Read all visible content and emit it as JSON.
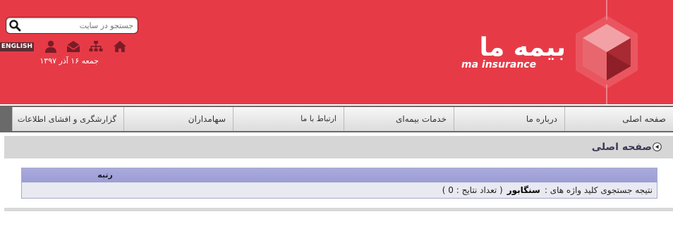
{
  "header": {
    "search": {
      "placeholder": "جستجو در سایت",
      "value": ""
    },
    "english_label": "ENGLISH",
    "date": "جمعه ۱۶ آذر ۱۳۹۷",
    "logo_fa": "بیمه ما",
    "logo_en": "ma insurance",
    "icons": [
      "home-icon",
      "sitemap-icon",
      "mail-icon",
      "user-icon",
      "search-icon"
    ]
  },
  "nav": {
    "items": [
      "صفحه اصلی",
      "درباره ما",
      "خدمات بیمه‌ای",
      "ارتباط با ما",
      "سهامداران",
      "گزارشگری و افشای اطلاعات"
    ]
  },
  "breadcrumb": {
    "title": "صفحه اصلی"
  },
  "results": {
    "rank_header": "رتبه",
    "prefix": "نتیجه جستجوی کلید واژه های :",
    "keyword": "سنگابور",
    "count": "( تعداد نتایج : 0 )"
  },
  "colors": {
    "header_bg": "#e63b47",
    "results_header_bg": "#a9aadd",
    "results_row_bg": "#e9e9f1"
  }
}
